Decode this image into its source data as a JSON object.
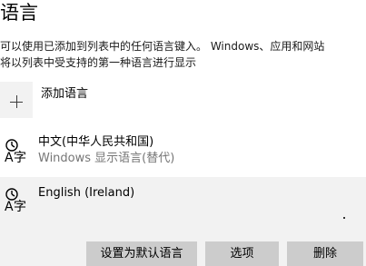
{
  "header": {
    "title": "语言",
    "description_line1": "可以使用已添加到列表中的任何语言键入。 Windows、应用和网站",
    "description_line2": "将以列表中受支持的第一种语言进行显示"
  },
  "add_language": {
    "label": "添加语言",
    "icon": "plus-icon"
  },
  "languages": [
    {
      "name": "中文(中华人民共和国)",
      "subtitle": "Windows 显示语言(替代)",
      "icon": "language-icon"
    },
    {
      "name": "English (Ireland)",
      "subtitle": "",
      "icon": "language-icon",
      "selected": true
    }
  ],
  "actions": {
    "set_default": "设置为默认语言",
    "options": "选项",
    "remove": "删除"
  },
  "colors": {
    "selected_row_bg": "#f2f2f2",
    "button_bg": "#cccccc",
    "secondary_text": "#767676"
  }
}
